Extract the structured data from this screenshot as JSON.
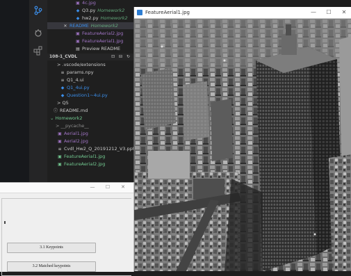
{
  "explorer": {
    "items": [
      {
        "label": "4c.jpg",
        "icon": "image-icon",
        "kind": "img",
        "indent": 40,
        "suffix": ""
      },
      {
        "label": "Q3.py",
        "icon": "python-icon",
        "kind": "py",
        "indent": 40,
        "suffix": "Homework2"
      },
      {
        "label": "hw2.py",
        "icon": "python-icon",
        "kind": "py",
        "indent": 40,
        "suffix": "Homework2"
      },
      {
        "label": "README",
        "icon": "close-icon",
        "kind": "sel",
        "indent": 22,
        "suffix": "Homework2"
      },
      {
        "label": "FeatureAerial2.jpg",
        "icon": "image-icon",
        "kind": "img",
        "indent": 40,
        "suffix": ""
      },
      {
        "label": "FeatureAerial1.jpg",
        "icon": "image-icon",
        "kind": "img",
        "indent": 40,
        "suffix": ""
      },
      {
        "label": "Preview README",
        "icon": "preview-icon",
        "kind": "plain",
        "indent": 40,
        "suffix": ""
      }
    ],
    "section_title": "108-1_CVDL",
    "section_tools": "⊡ ⊟ ↻",
    "tree": [
      {
        "label": "> .vscode/extensions",
        "icon": "",
        "kind": "plain",
        "indent": 14
      },
      {
        "label": "params.npy",
        "icon": "≡",
        "kind": "plain",
        "indent": 18
      },
      {
        "label": "Q1_4.ui",
        "icon": "≡",
        "kind": "plain",
        "indent": 18
      },
      {
        "label": "Q1_4ui.py",
        "icon": "◆",
        "kind": "py",
        "indent": 18
      },
      {
        "label": "Question1~4ui.py",
        "icon": "◆",
        "kind": "py",
        "indent": 18
      },
      {
        "label": "> Q5",
        "icon": "",
        "kind": "plain",
        "indent": 14
      },
      {
        "label": "README.md",
        "icon": "ⓘ",
        "kind": "plain",
        "indent": 8
      },
      {
        "label": "⌄ Homework2",
        "icon": "",
        "kind": "green",
        "indent": 4
      },
      {
        "label": "> __pycache__",
        "icon": "",
        "kind": "gray",
        "indent": 12
      },
      {
        "label": "Aerial1.jpg",
        "icon": "▣",
        "kind": "img",
        "indent": 14
      },
      {
        "label": "Aerial2.jpg",
        "icon": "▣",
        "kind": "img",
        "indent": 14
      },
      {
        "label": "Cvdl_Hw2_Q_20191212_V3.pptx",
        "icon": "≡",
        "kind": "plain",
        "indent": 14
      },
      {
        "label": "FeatureAerial1.jpg",
        "icon": "▣",
        "kind": "green",
        "indent": 14
      },
      {
        "label": "FeatureAerial2.jpg",
        "icon": "▣",
        "kind": "green",
        "indent": 14
      }
    ]
  },
  "image_window": {
    "title": "FeatureAerial1.jpg",
    "minimize": "—",
    "maximize": "☐",
    "close": "✕"
  },
  "dialog": {
    "minimize": "—",
    "maximize": "☐",
    "close": "✕",
    "buttons": [
      "3.1 Keypoints",
      "3.2 Matched keypoints"
    ]
  }
}
